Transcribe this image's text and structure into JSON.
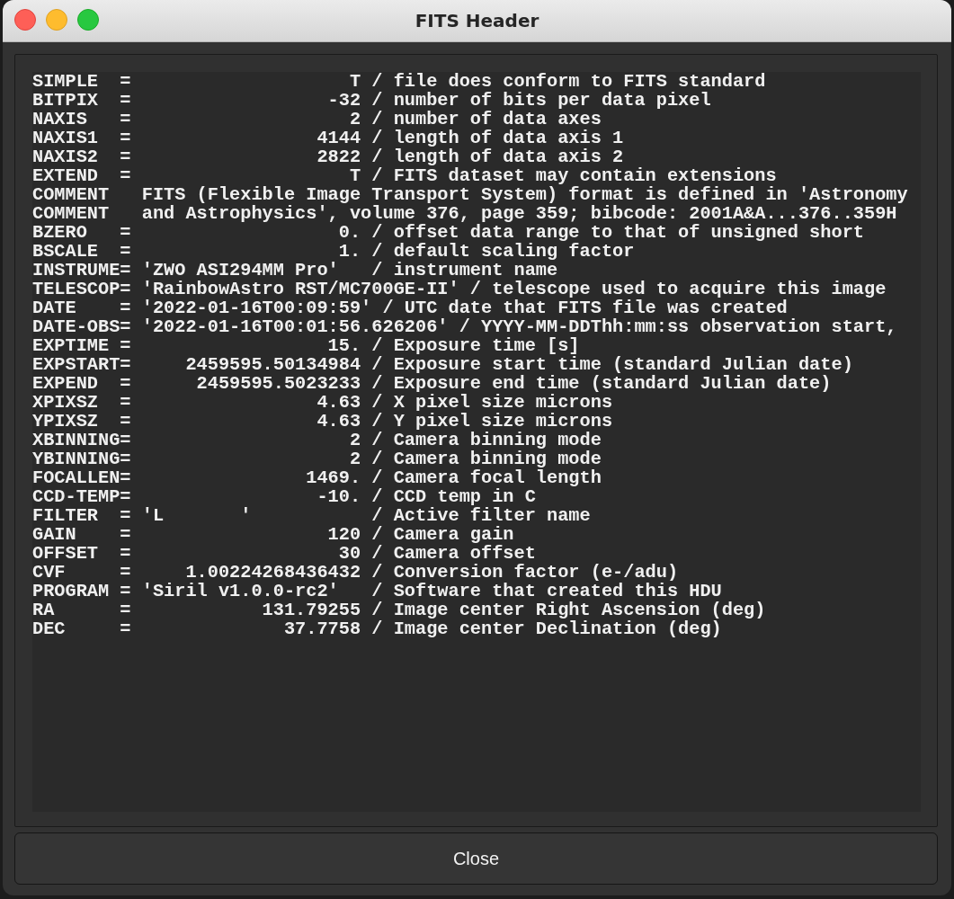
{
  "window": {
    "title": "FITS Header"
  },
  "header_lines": [
    "SIMPLE  =                    T / file does conform to FITS standard",
    "BITPIX  =                  -32 / number of bits per data pixel",
    "NAXIS   =                    2 / number of data axes",
    "NAXIS1  =                 4144 / length of data axis 1",
    "NAXIS2  =                 2822 / length of data axis 2",
    "EXTEND  =                    T / FITS dataset may contain extensions",
    "COMMENT   FITS (Flexible Image Transport System) format is defined in 'Astronomy",
    "COMMENT   and Astrophysics', volume 376, page 359; bibcode: 2001A&A...376..359H",
    "BZERO   =                   0. / offset data range to that of unsigned short",
    "BSCALE  =                   1. / default scaling factor",
    "INSTRUME= 'ZWO ASI294MM Pro'   / instrument name",
    "TELESCOP= 'RainbowAstro RST/MC700GE-II' / telescope used to acquire this image",
    "DATE    = '2022-01-16T00:09:59' / UTC date that FITS file was created",
    "DATE-OBS= '2022-01-16T00:01:56.626206' / YYYY-MM-DDThh:mm:ss observation start,",
    "EXPTIME =                  15. / Exposure time [s]",
    "EXPSTART=     2459595.50134984 / Exposure start time (standard Julian date)",
    "EXPEND  =      2459595.5023233 / Exposure end time (standard Julian date)",
    "XPIXSZ  =                 4.63 / X pixel size microns",
    "YPIXSZ  =                 4.63 / Y pixel size microns",
    "XBINNING=                    2 / Camera binning mode",
    "YBINNING=                    2 / Camera binning mode",
    "FOCALLEN=                1469. / Camera focal length",
    "CCD-TEMP=                 -10. / CCD temp in C",
    "FILTER  = 'L       '           / Active filter name",
    "GAIN    =                  120 / Camera gain",
    "OFFSET  =                   30 / Camera offset",
    "CVF     =     1.00224268436432 / Conversion factor (e-/adu)",
    "PROGRAM = 'Siril v1.0.0-rc2'   / Software that created this HDU",
    "RA      =            131.79255 / Image center Right Ascension (deg)",
    "DEC     =              37.7758 / Image center Declination (deg)"
  ],
  "buttons": [
    "Close"
  ]
}
